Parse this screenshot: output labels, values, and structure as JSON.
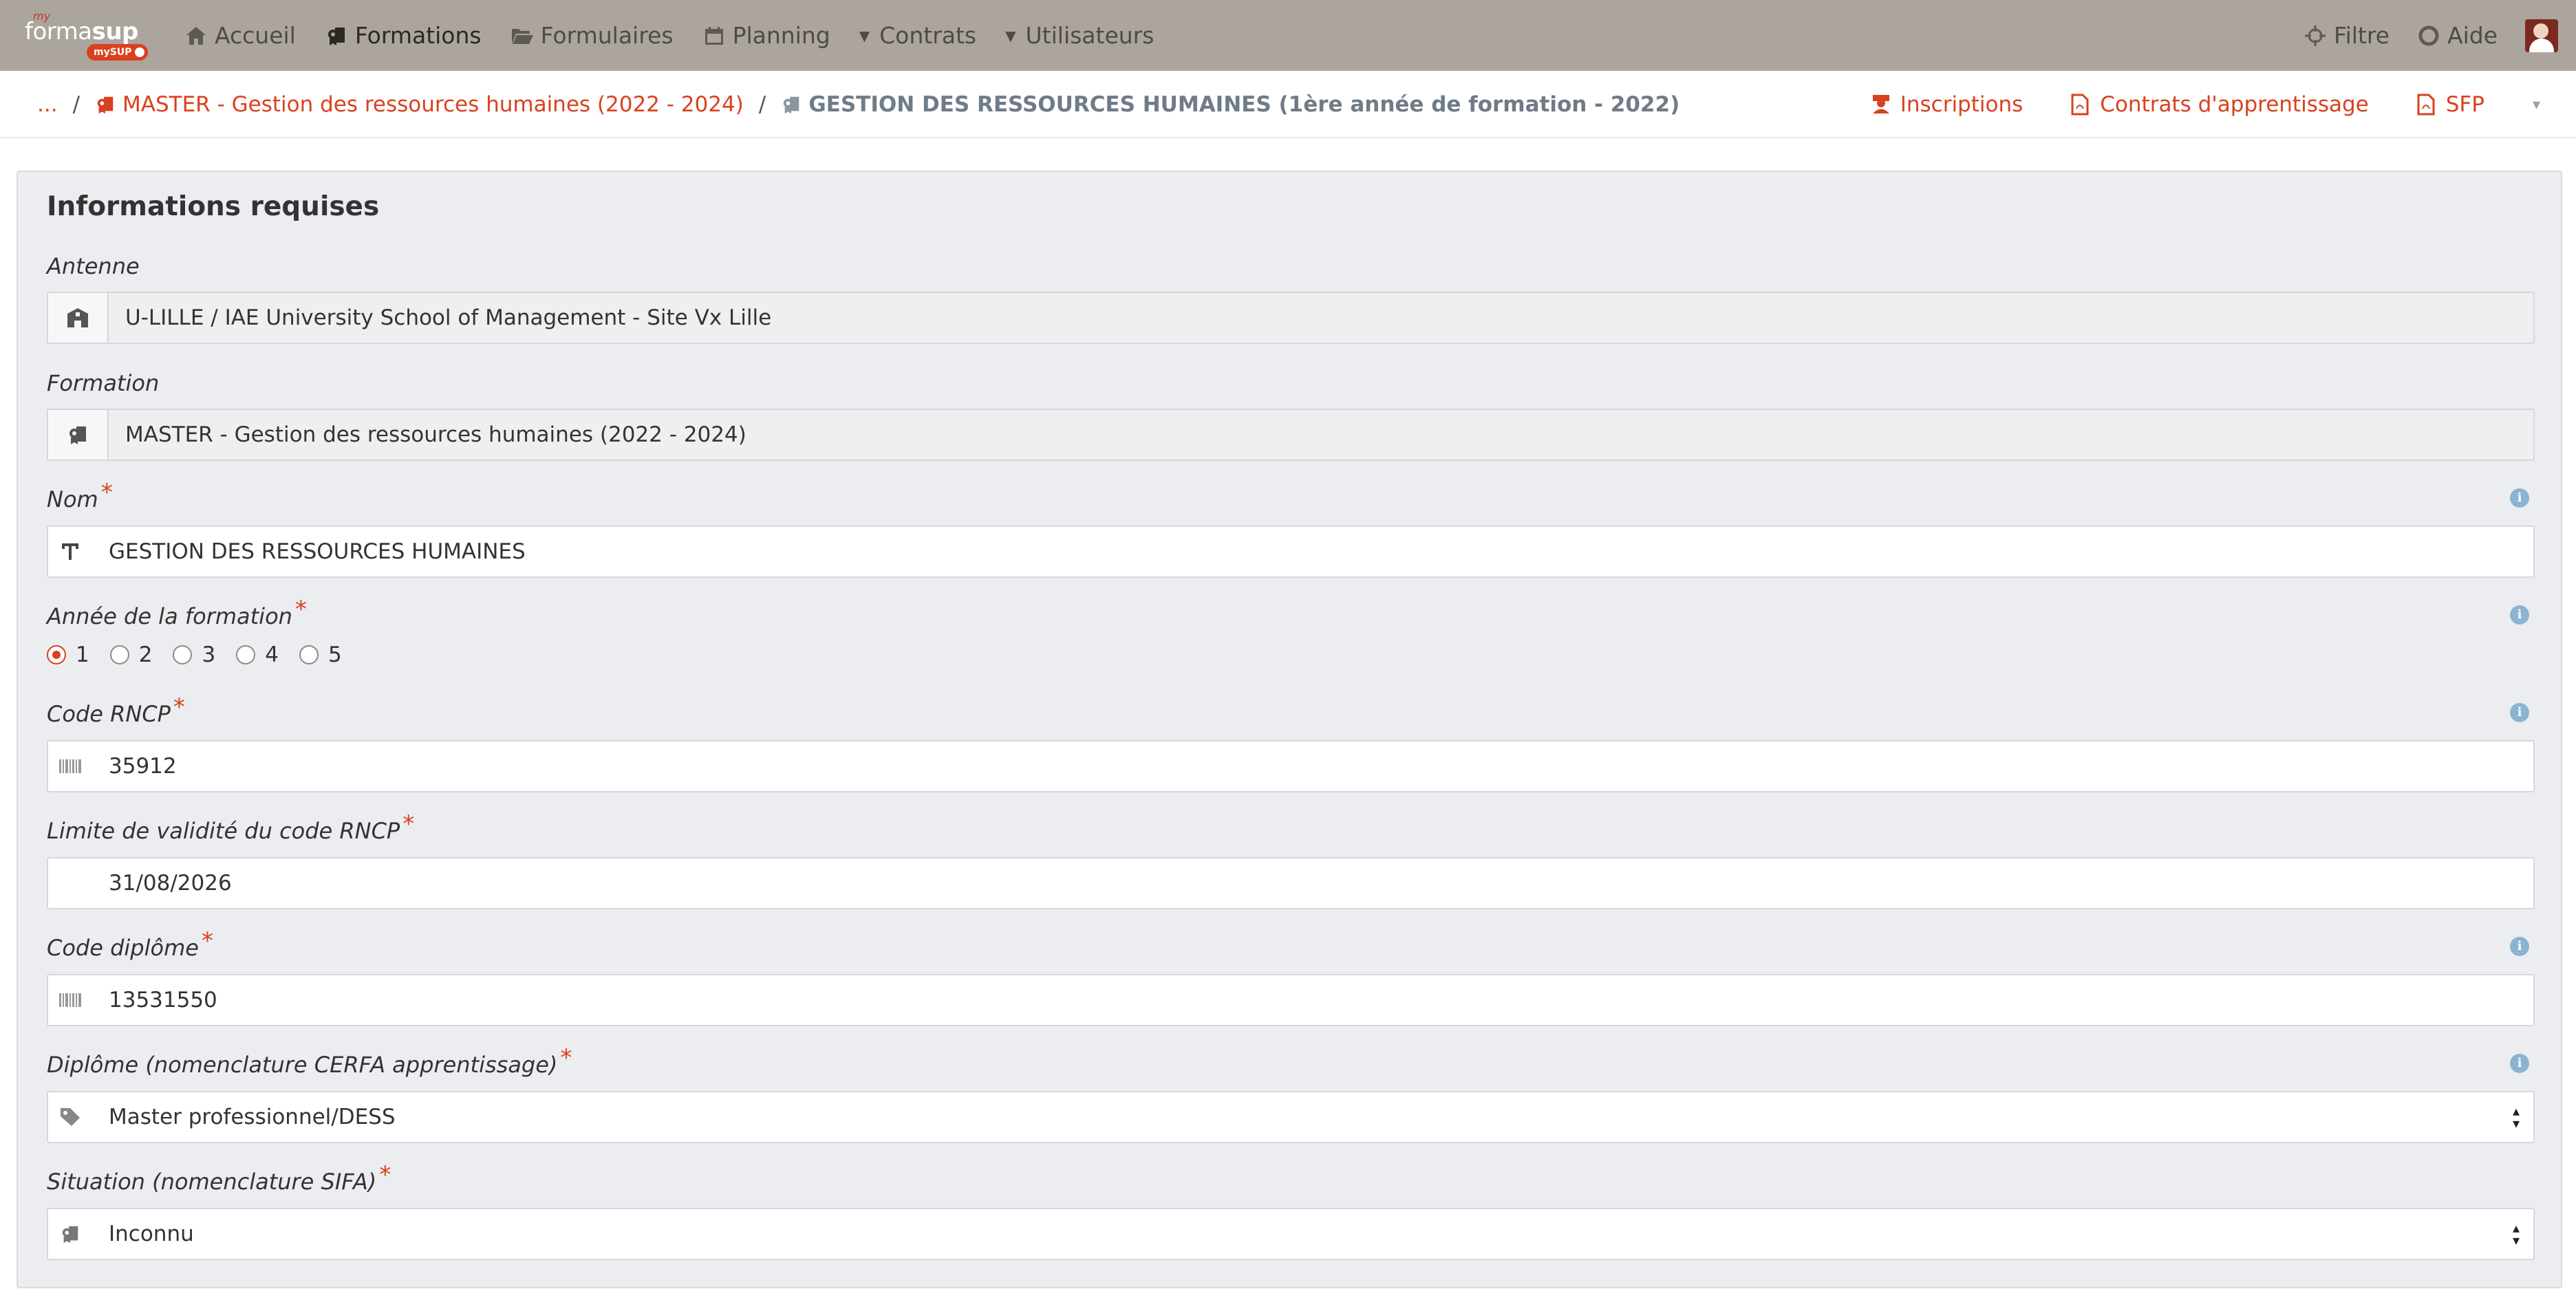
{
  "navbar": {
    "logo": {
      "my": "my",
      "formasup_a": "forma",
      "formasup_b": "sup",
      "badge": "mySUP"
    },
    "items": [
      {
        "label": "Accueil",
        "icon": "home-icon"
      },
      {
        "label": "Formations",
        "icon": "formation-icon",
        "active": true
      },
      {
        "label": "Formulaires",
        "icon": "folder-open-icon"
      },
      {
        "label": "Planning",
        "icon": "calendar-icon"
      },
      {
        "label": "Contrats",
        "icon": "caret-down-icon"
      },
      {
        "label": "Utilisateurs",
        "icon": "caret-down-icon"
      }
    ],
    "right": [
      {
        "label": "Filtre",
        "icon": "crosshair-icon"
      },
      {
        "label": "Aide",
        "icon": "lifebuoy-icon"
      }
    ]
  },
  "breadcrumb": {
    "ellipsis": "...",
    "parent": "MASTER - Gestion des ressources humaines (2022 - 2024)",
    "current": "GESTION DES RESSOURCES HUMAINES (1ère année de formation - 2022)",
    "separator": "/"
  },
  "actions": {
    "inscriptions": "Inscriptions",
    "contrats": "Contrats d'apprentissage",
    "sfp": "SFP",
    "more": "▾"
  },
  "form": {
    "title": "Informations requises",
    "antenne": {
      "label": "Antenne",
      "value": "U-LILLE / IAE University School of Management - Site Vx Lille"
    },
    "formation": {
      "label": "Formation",
      "value": "MASTER - Gestion des ressources humaines (2022 - 2024)"
    },
    "nom": {
      "label": "Nom",
      "value": "GESTION DES RESSOURCES HUMAINES"
    },
    "annee": {
      "label": "Année de la formation",
      "options": [
        "1",
        "2",
        "3",
        "4",
        "5"
      ],
      "selected": "1"
    },
    "rncp": {
      "label": "Code RNCP",
      "value": "35912"
    },
    "limite": {
      "label": "Limite de validité du code RNCP",
      "value": "31/08/2026"
    },
    "diplome": {
      "label": "Code diplôme",
      "value": "13531550"
    },
    "cerfa": {
      "label": "Diplôme (nomenclature CERFA apprentissage)",
      "value": "Master professionnel/DESS"
    },
    "sifa": {
      "label": "Situation (nomenclature SIFA)",
      "value": "Inconnu"
    },
    "required_mark": "*",
    "info_mark": "i"
  },
  "colors": {
    "navbar": "#aba59e",
    "accent": "#d9411e",
    "panel": "#ebedf0",
    "info": "#8ab4d0"
  }
}
